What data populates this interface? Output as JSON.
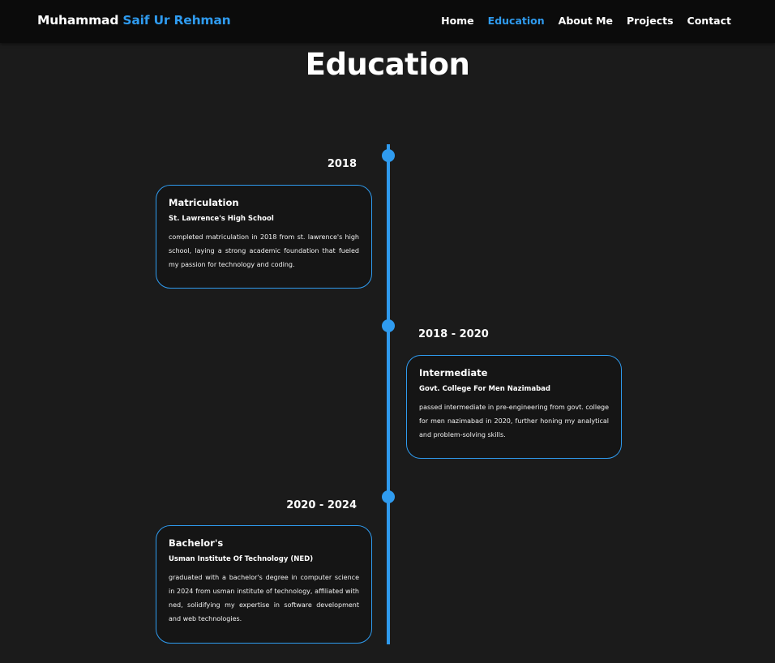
{
  "nav": {
    "brand_first": "Muhammad",
    "brand_accent": "Saif Ur Rehman",
    "links": [
      "Home",
      "Education",
      "About Me",
      "Projects",
      "Contact"
    ],
    "active": "Education"
  },
  "page": {
    "title": "Education"
  },
  "theme": {
    "accent": "#2f9bef",
    "background": "#1b1b1b",
    "navbar": "#0b0b0b"
  },
  "timeline": [
    {
      "year": "2018",
      "title": "Matriculation",
      "school": "St. Lawrence's High School",
      "description": "completed matriculation in 2018 from st. lawrence's high school, laying a strong academic foundation that fueled my passion for technology and coding."
    },
    {
      "year": "2018 - 2020",
      "title": "Intermediate",
      "school": "Govt. College For Men Nazimabad",
      "description": "passed intermediate in pre-engineering from govt. college for men nazimabad in 2020, further honing my analytical and problem-solving skills."
    },
    {
      "year": "2020 - 2024",
      "title": "Bachelor's",
      "school": "Usman Institute Of Technology (NED)",
      "description": "graduated with a bachelor's degree in computer science in 2024 from usman institute of technology, affiliated with ned, solidifying my expertise in software development and web technologies."
    }
  ]
}
